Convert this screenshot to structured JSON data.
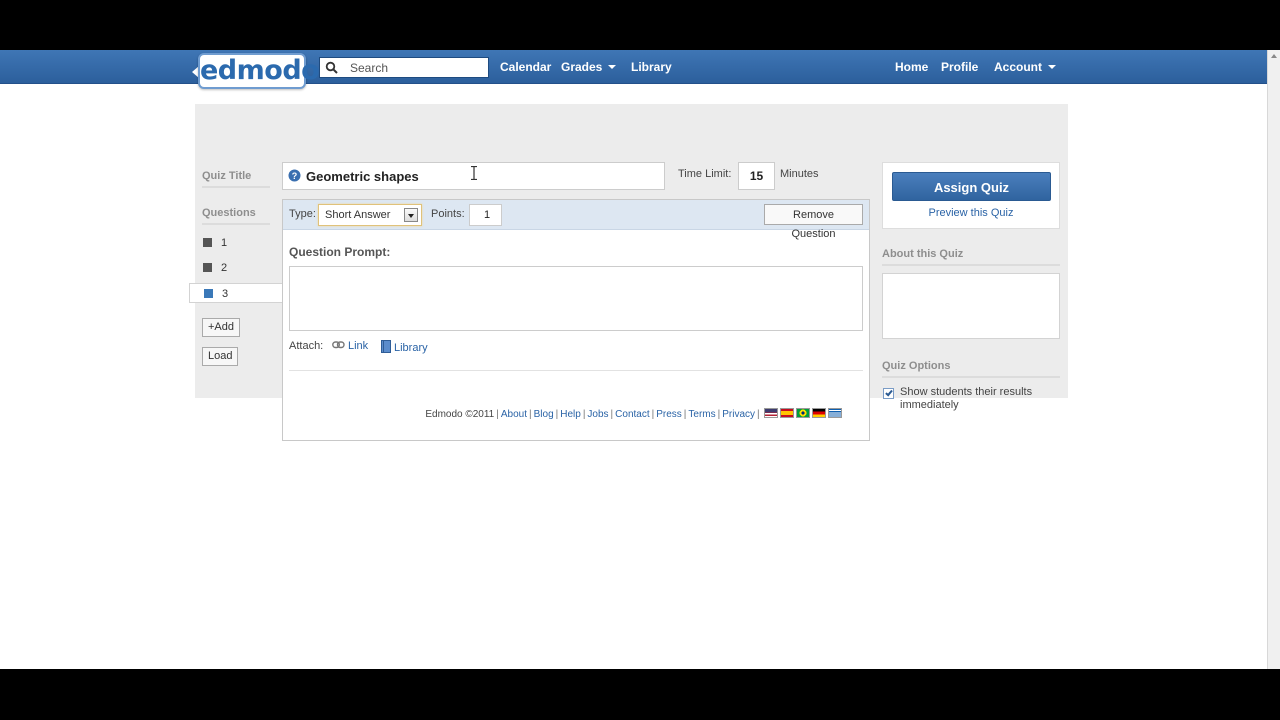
{
  "nav": {
    "logo": "edmodo",
    "search_placeholder": "Search",
    "left_links": [
      {
        "label": "Calendar"
      },
      {
        "label": "Grades"
      },
      {
        "label": "Library"
      }
    ],
    "right_links": [
      {
        "label": "Home"
      },
      {
        "label": "Profile"
      },
      {
        "label": "Account"
      }
    ]
  },
  "sidebar": {
    "quiz_title_label": "Quiz Title",
    "questions_label": "Questions",
    "questions": [
      "1",
      "2",
      "3"
    ],
    "active_question": "3",
    "add_label": "+Add",
    "load_label": "Load"
  },
  "quiz": {
    "title": "Geometric shapes",
    "time_limit_label": "Time Limit:",
    "time_limit_value": "15",
    "minutes_label": "Minutes"
  },
  "editor": {
    "type_label": "Type:",
    "type_value": "Short Answer",
    "points_label": "Points:",
    "points_value": "1",
    "remove_label": "Remove Question",
    "prompt_label": "Question Prompt:",
    "prompt_text": "",
    "attach_label": "Attach:",
    "attach_links": [
      "Link",
      "Library"
    ]
  },
  "right_panel": {
    "assign_label": "Assign Quiz",
    "preview_label": "Preview this Quiz",
    "about_label": "About this Quiz",
    "options_label": "Quiz Options",
    "show_results_label": "Show students their results immediately",
    "show_results_checked": true
  },
  "footer": {
    "copyright": "Edmodo ©2011",
    "links": [
      "About",
      "Blog",
      "Help",
      "Jobs",
      "Contact",
      "Press",
      "Terms",
      "Privacy"
    ],
    "flags": [
      "flag-us-icon",
      "flag-es-icon",
      "flag-br-icon",
      "flag-de-icon",
      "flag-gr-icon"
    ]
  },
  "colors": {
    "nav_blue": "#3f76b5",
    "link_blue": "#2a63a6",
    "panel_gray": "#ececec",
    "toolbar_blue": "#dde7f2"
  }
}
